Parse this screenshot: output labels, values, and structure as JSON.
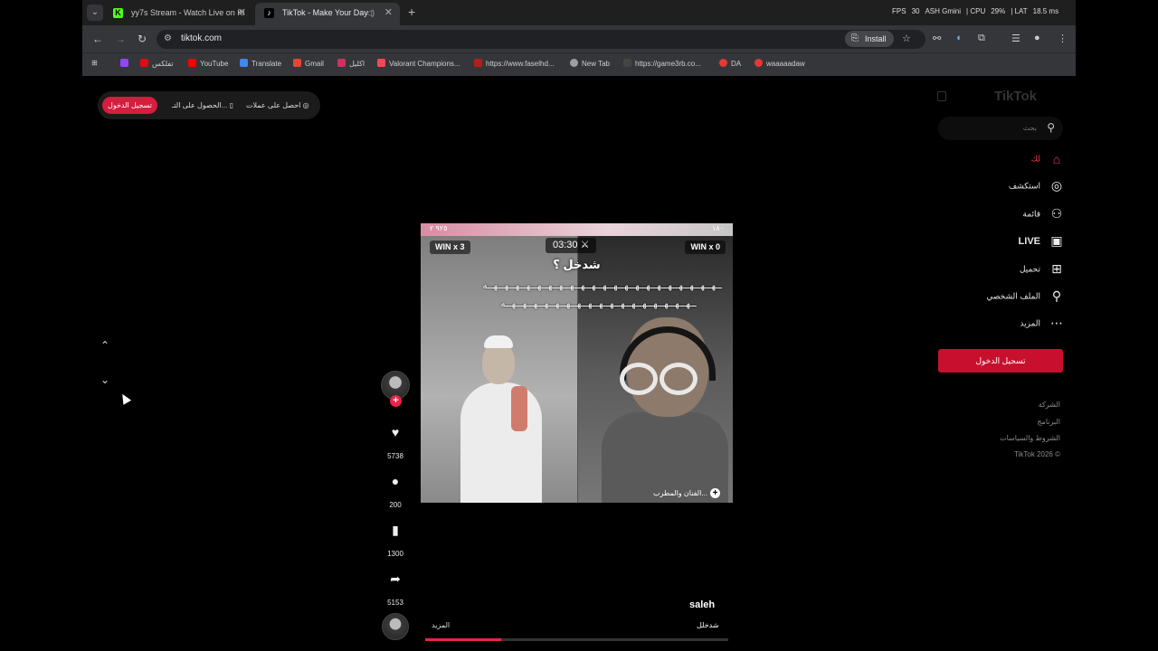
{
  "browser": {
    "tabs": [
      {
        "title": "yy7s Stream - Watch Live on Ki",
        "favicon": "K"
      },
      {
        "title": "TikTok - Make Your Day",
        "favicon": "♪"
      }
    ],
    "url": "tiktok.com",
    "install_label": "Install",
    "overlay": {
      "fps": "FPS",
      "fps_val": "30",
      "gpu": "ASH Gmini",
      "cpu": "CPU",
      "cpu_val": "29%",
      "lat": "LAT",
      "lat_val": "18.5 ms"
    },
    "bookmarks": [
      {
        "label": "",
        "color": "#9146ff"
      },
      {
        "label": "تفلكس",
        "color": "#e50914"
      },
      {
        "label": "YouTube",
        "color": "#ff0000"
      },
      {
        "label": "Translate",
        "color": "#4285f4"
      },
      {
        "label": "Gmail",
        "color": "#ea4335"
      },
      {
        "label": "اكليل",
        "color": "#d32f5f"
      },
      {
        "label": "Valorant Champions...",
        "color": "#ff4655"
      },
      {
        "label": "https://www.faselhd...",
        "color": "#b71c1c"
      },
      {
        "label": "New Tab",
        "color": "#9e9e9e"
      },
      {
        "label": "https://game3rb.co...",
        "color": "#444444"
      },
      {
        "label": "DA",
        "color": "#e53935"
      },
      {
        "label": "waaaaadaw",
        "color": "#e53935"
      }
    ]
  },
  "top_bar": {
    "login": "تسجيل الدخول",
    "get_app": "الحصول على التـ...",
    "get_coins": "احصل على عملات"
  },
  "video": {
    "win_left": "WIN x 3",
    "win_right": "WIN x 0",
    "timer": "03:30",
    "top_left": "٩٢٥ ٢",
    "top_right": "١٨٠",
    "overlay_title": "شدخل ؟",
    "wave1": "ـهـهـهـهـهـهـهـهـهـهـهـهـهـهـهـهـهـهـهـهـهـه",
    "wave2": "ـهـهـهـهـهـهـهـهـهـهـهـهـهـهـهـهـهـه",
    "sound_label": "الفنان والمطرب..."
  },
  "actions": {
    "likes": "5738",
    "comments": "200",
    "saves": "1300",
    "shares": "5153"
  },
  "post": {
    "creator": "saleh",
    "caption": "شدخلل",
    "more": "المزيد",
    "progress": 0.25
  },
  "sidebar": {
    "logo": "TikTok",
    "search_placeholder": "بحث",
    "nav": [
      {
        "label": "لك",
        "icon": "⌂"
      },
      {
        "label": "استكشف",
        "icon": "◎"
      },
      {
        "label": "قائمة",
        "icon": "⚇"
      },
      {
        "label": "LIVE",
        "icon": "▣"
      },
      {
        "label": "تحميل",
        "icon": "⊞"
      },
      {
        "label": "الملف الشخصي",
        "icon": "⚲"
      },
      {
        "label": "المزيد",
        "icon": "⋯"
      }
    ],
    "login": "تسجيل الدخول",
    "footer": [
      "الشركة",
      "البرنامج",
      "الشروط والسياسات",
      "TikTok 2026 ©"
    ]
  },
  "colors": {
    "accent": "#fe2c55",
    "login_button": "#c8102e"
  }
}
